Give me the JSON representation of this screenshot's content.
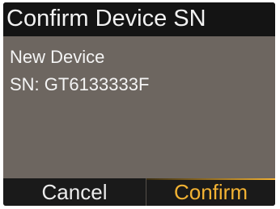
{
  "header": {
    "title": "Confirm Device SN"
  },
  "body": {
    "line1": "New Device",
    "line2": "SN: GT6133333F"
  },
  "softkeys": {
    "left_label": "Cancel",
    "right_label": "Confirm"
  },
  "colors": {
    "screen_background": "#6d6660",
    "title_bar": "#141414",
    "softkey_bar": "#1a1a1a",
    "accent": "#f2b233"
  }
}
